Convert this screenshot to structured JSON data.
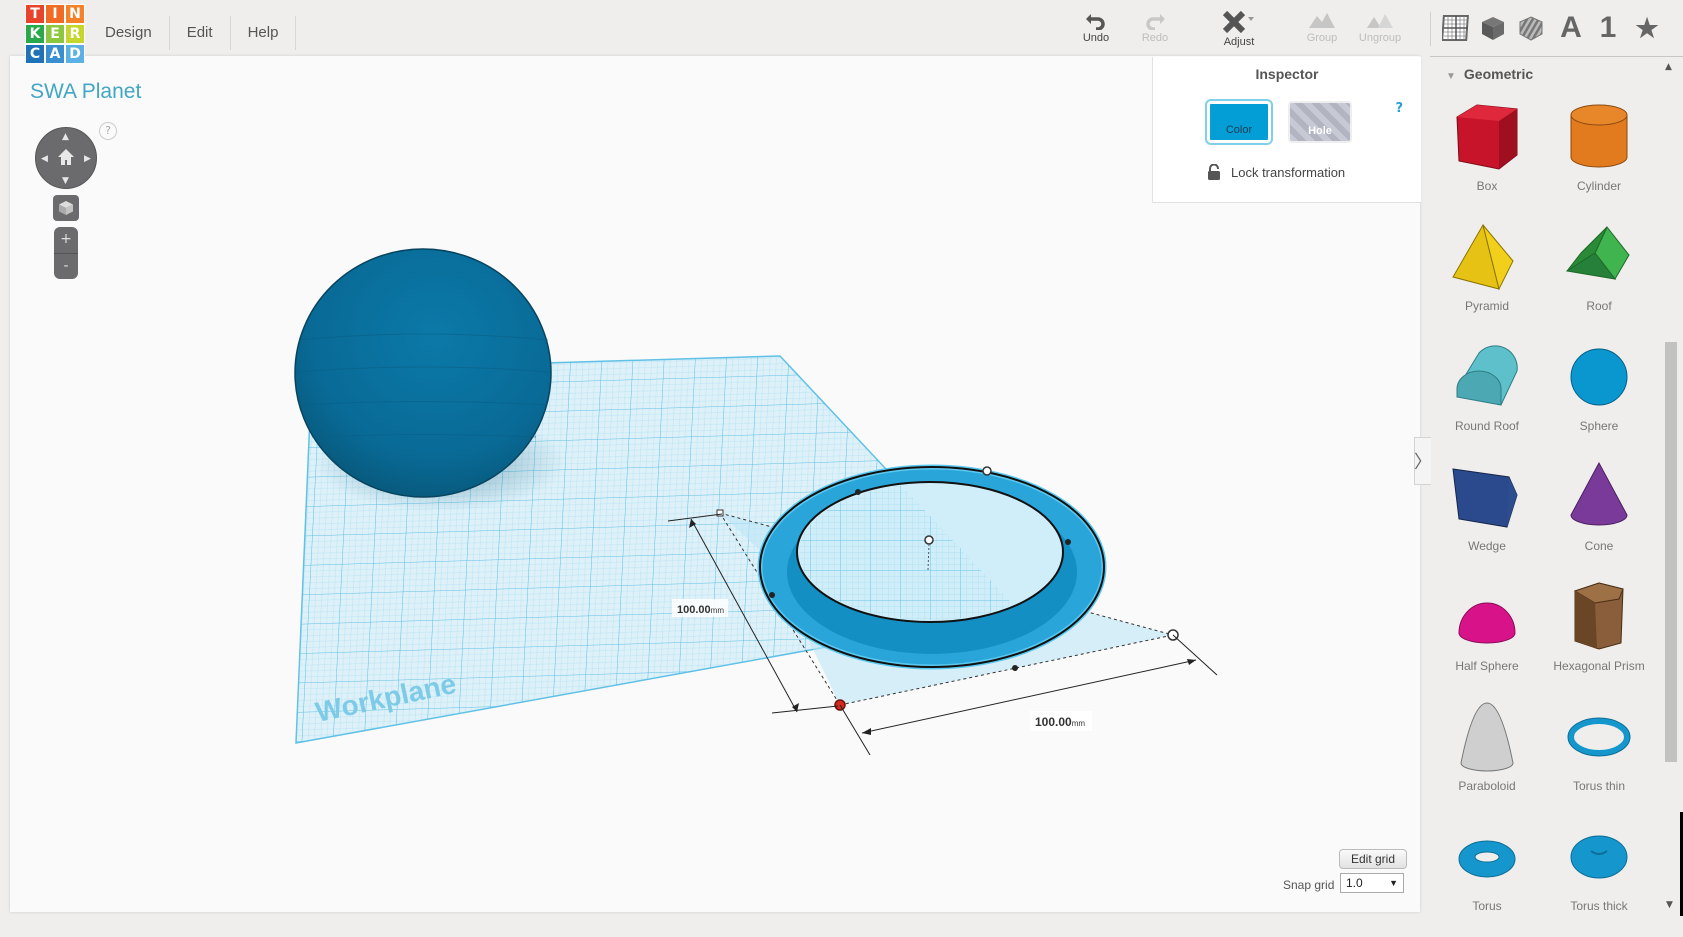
{
  "app": {
    "logo_letters": [
      "T",
      "I",
      "N",
      "K",
      "E",
      "R",
      "C",
      "A",
      "D"
    ],
    "logo_colors": [
      "#e8442c",
      "#f26b25",
      "#f5822b",
      "#29a94a",
      "#8dc63f",
      "#c5d72e",
      "#1f72b8",
      "#3a8fd1",
      "#5bb1e3"
    ]
  },
  "menu": [
    {
      "label": "Design"
    },
    {
      "label": "Edit"
    },
    {
      "label": "Help"
    }
  ],
  "toolbar": {
    "undo": {
      "label": "Undo",
      "icon": "undo-icon",
      "enabled": true
    },
    "redo": {
      "label": "Redo",
      "icon": "redo-icon",
      "enabled": false
    },
    "adjust": {
      "label": "Adjust",
      "icon": "adjust-icon",
      "enabled": true
    },
    "group": {
      "label": "Group",
      "icon": "group-icon",
      "enabled": false
    },
    "ungroup": {
      "label": "Ungroup",
      "icon": "ungroup-icon",
      "enabled": false
    }
  },
  "view_icons": [
    {
      "name": "workplane-grid-icon"
    },
    {
      "name": "solid-cube-icon"
    },
    {
      "name": "hole-cube-icon"
    },
    {
      "name": "text-icon",
      "text": "A"
    },
    {
      "name": "number-icon",
      "text": "1"
    },
    {
      "name": "star-icon",
      "text": "★"
    }
  ],
  "design": {
    "title": "SWA Planet",
    "workplane_label": "Workplane",
    "dimension_depth": {
      "value": "100.00",
      "unit": "mm"
    },
    "dimension_width": {
      "value": "100.00",
      "unit": "mm"
    },
    "object_color": "#0a6c9b",
    "selected_color": "#1f9fd4"
  },
  "navigation": {
    "help": "?",
    "zoom_in": "+",
    "zoom_out": "-"
  },
  "inspector": {
    "title": "Inspector",
    "color_label": "Color",
    "hole_label": "Hole",
    "help": "?",
    "lock_label": "Lock transformation",
    "selected_color": "#039ed6"
  },
  "grid": {
    "edit_grid_label": "Edit grid",
    "snap_label": "Snap grid",
    "snap_value": "1.0"
  },
  "sidebar": {
    "category": "Geometric",
    "shapes": [
      {
        "label": "Box",
        "color": "#c8142a"
      },
      {
        "label": "Cylinder",
        "color": "#e27a1e"
      },
      {
        "label": "Pyramid",
        "color": "#f1cf1a"
      },
      {
        "label": "Roof",
        "color": "#3aa547"
      },
      {
        "label": "Round Roof",
        "color": "#5ec0ca"
      },
      {
        "label": "Sphere",
        "color": "#0a97cf"
      },
      {
        "label": "Wedge",
        "color": "#2a4a8d"
      },
      {
        "label": "Cone",
        "color": "#7a3a99"
      },
      {
        "label": "Half Sphere",
        "color": "#d8138a"
      },
      {
        "label": "Hexagonal Prism",
        "color": "#8a5e3a"
      },
      {
        "label": "Paraboloid",
        "color": "#cfcfcf"
      },
      {
        "label": "Torus thin",
        "color": "#1596cc"
      },
      {
        "label": "Torus",
        "color": "#1596cc"
      },
      {
        "label": "Torus thick",
        "color": "#1596cc"
      }
    ]
  }
}
